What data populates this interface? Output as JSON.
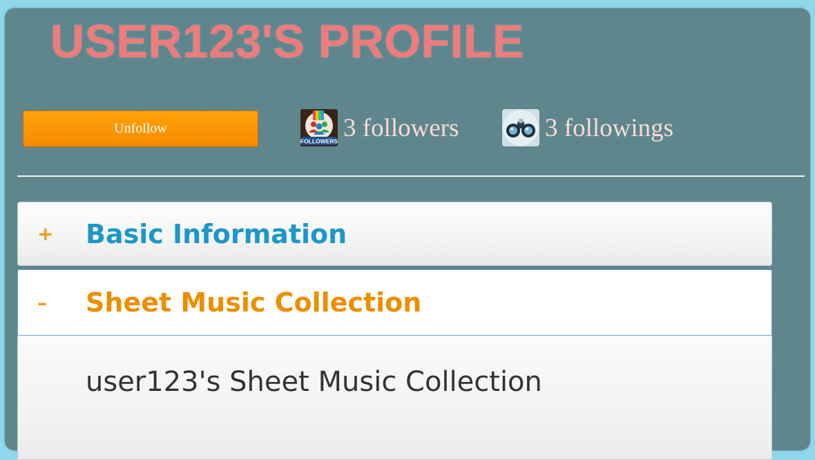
{
  "profile": {
    "title": "USER123'S PROFILE",
    "unfollow_label": "Unfollow",
    "followers": {
      "text": "3 followers",
      "icon": "followers-icon",
      "icon_label": "FOLLOWERS"
    },
    "followings": {
      "text": "3 followings",
      "icon": "binoculars-icon"
    }
  },
  "accordion": {
    "sections": [
      {
        "sign": "+",
        "title": "Basic Information",
        "expanded": false
      },
      {
        "sign": "–",
        "title": "Sheet Music Collection",
        "expanded": true
      }
    ],
    "collection_heading": "user123's Sheet Music Collection"
  },
  "colors": {
    "background": "#8fd8ec",
    "panel": "#5f868d",
    "title": "#ef7b7b",
    "button": "#f78a00",
    "link_blue": "#1c97c8",
    "active_orange": "#ec8f00"
  }
}
